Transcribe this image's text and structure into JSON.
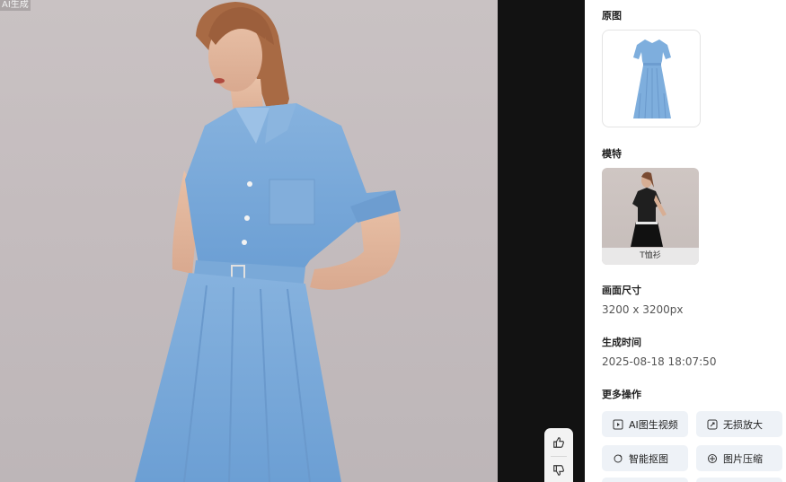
{
  "viewer": {
    "ai_tag": "AI生成",
    "feedback": {
      "like_icon": "thumbs-up-icon",
      "dislike_icon": "thumbs-down-icon"
    }
  },
  "panel": {
    "original": {
      "title": "原图"
    },
    "model": {
      "title": "模特",
      "caption": "T恤衫"
    },
    "size": {
      "title": "画面尺寸",
      "value": "3200 x 3200px"
    },
    "time": {
      "title": "生成时间",
      "value": "2025-08-18 18:07:50"
    },
    "more": {
      "title": "更多操作",
      "actions": [
        {
          "label": "AI图生视频",
          "icon": "video-icon"
        },
        {
          "label": "无损放大",
          "icon": "upscale-icon"
        },
        {
          "label": "智能抠图",
          "icon": "cutout-icon"
        },
        {
          "label": "图片压缩",
          "icon": "compress-icon"
        }
      ]
    }
  },
  "colors": {
    "dress_blue": "#79a9da",
    "panel_button_bg": "#eef2f7",
    "stage_bg": "#121212"
  }
}
